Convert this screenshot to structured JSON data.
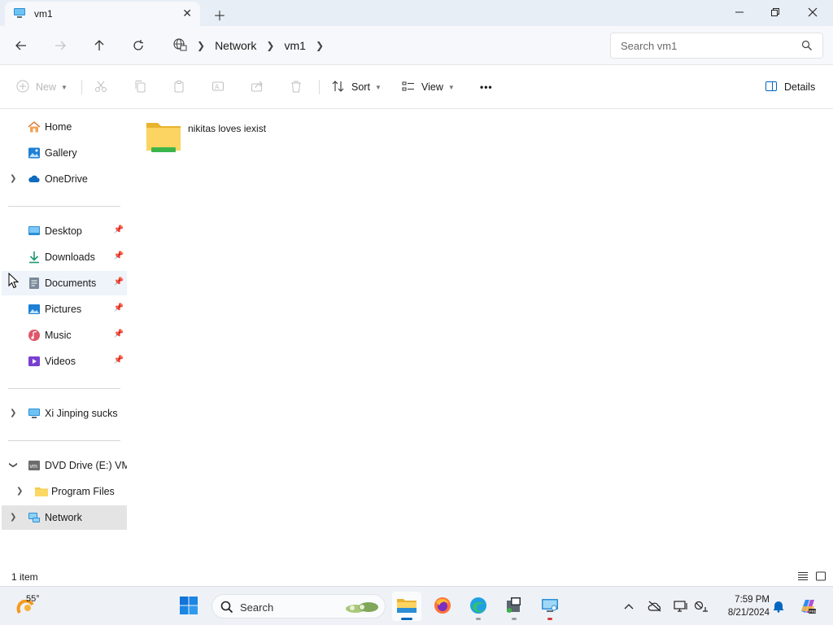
{
  "window": {
    "tab_title": "vm1",
    "controls": {
      "minimize": "minimize",
      "maximize": "restore",
      "close": "close"
    }
  },
  "address": {
    "breadcrumbs": [
      "Network",
      "vm1"
    ],
    "search_placeholder": "Search vm1"
  },
  "commands": {
    "new": "New",
    "sort": "Sort",
    "view": "View",
    "more": "•••",
    "details": "Details"
  },
  "sidebar": {
    "quick": [
      {
        "label": "Home",
        "icon": "home-icon",
        "expandable": false
      },
      {
        "label": "Gallery",
        "icon": "gallery-icon",
        "expandable": false
      },
      {
        "label": "OneDrive",
        "icon": "cloud-icon",
        "expandable": true
      }
    ],
    "pinned": [
      {
        "label": "Desktop",
        "icon": "desktop-icon"
      },
      {
        "label": "Downloads",
        "icon": "download-icon"
      },
      {
        "label": "Documents",
        "icon": "documents-icon"
      },
      {
        "label": "Pictures",
        "icon": "pictures-icon"
      },
      {
        "label": "Music",
        "icon": "music-icon"
      },
      {
        "label": "Videos",
        "icon": "videos-icon"
      }
    ],
    "pc": {
      "label": "Xi Jinping sucks",
      "icon": "computer-icon"
    },
    "drives": [
      {
        "label": "DVD Drive (E:) VMware Tools",
        "icon": "dvd-drive-icon",
        "expanded": true
      },
      {
        "label": "Program Files",
        "icon": "folder-icon",
        "expanded": false
      }
    ],
    "network": {
      "label": "Network",
      "icon": "network-icon"
    }
  },
  "content": {
    "items": [
      {
        "name": "nikitas loves iexist",
        "type": "network-share-folder"
      }
    ]
  },
  "status": {
    "count": "1 item"
  },
  "taskbar": {
    "weather_temp": "55°",
    "search_label": "Search",
    "apps": [
      "file-explorer",
      "firefox",
      "edge",
      "vmware-tools",
      "network-app"
    ],
    "time": "7:59 PM",
    "date": "8/21/2024"
  },
  "colors": {
    "accent": "#0067c0",
    "folder_yellow": "#f7c948",
    "share_green": "#3bb54a",
    "selected_bg": "#e4e4e4",
    "hover_bg": "#eef4fa"
  }
}
